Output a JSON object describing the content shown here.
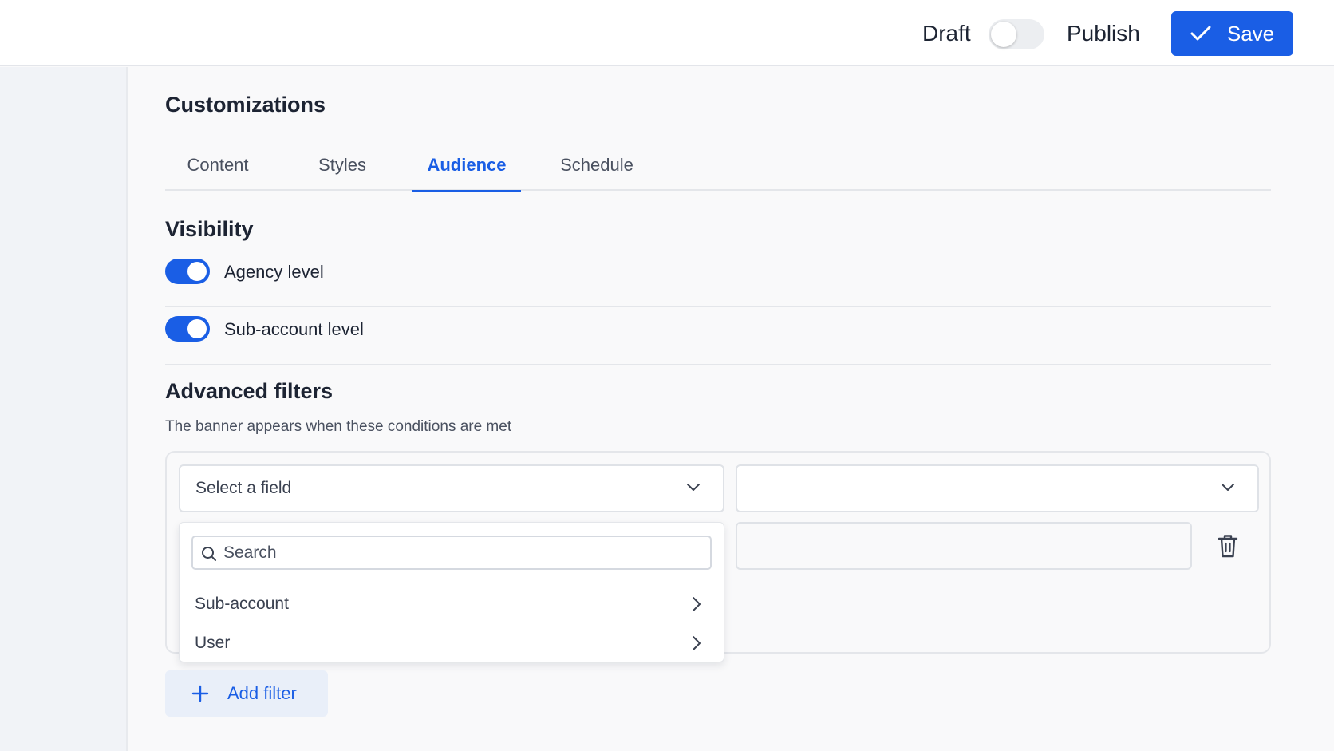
{
  "topbar": {
    "draft_label": "Draft",
    "publish_label": "Publish",
    "save_label": "Save"
  },
  "page": {
    "title": "Customizations",
    "tabs": [
      {
        "label": "Content",
        "active": false
      },
      {
        "label": "Styles",
        "active": false
      },
      {
        "label": "Audience",
        "active": true
      },
      {
        "label": "Schedule",
        "active": false
      }
    ]
  },
  "visibility": {
    "title": "Visibility",
    "toggles": [
      {
        "label": "Agency level",
        "on": true
      },
      {
        "label": "Sub-account level",
        "on": true
      }
    ]
  },
  "advanced_filters": {
    "title": "Advanced filters",
    "description": "The banner appears when these conditions are met",
    "field_select": {
      "value": "Select a field"
    },
    "operator_select": {
      "value": ""
    },
    "value_input": {
      "value": ""
    },
    "dropdown": {
      "search_placeholder": "Search",
      "items": [
        {
          "label": "Sub-account"
        },
        {
          "label": "User"
        }
      ]
    },
    "add_filter_label": "Add filter"
  },
  "colors": {
    "accent": "#1a5ee5",
    "text": "#1d2433",
    "muted_text": "#4a5160"
  }
}
